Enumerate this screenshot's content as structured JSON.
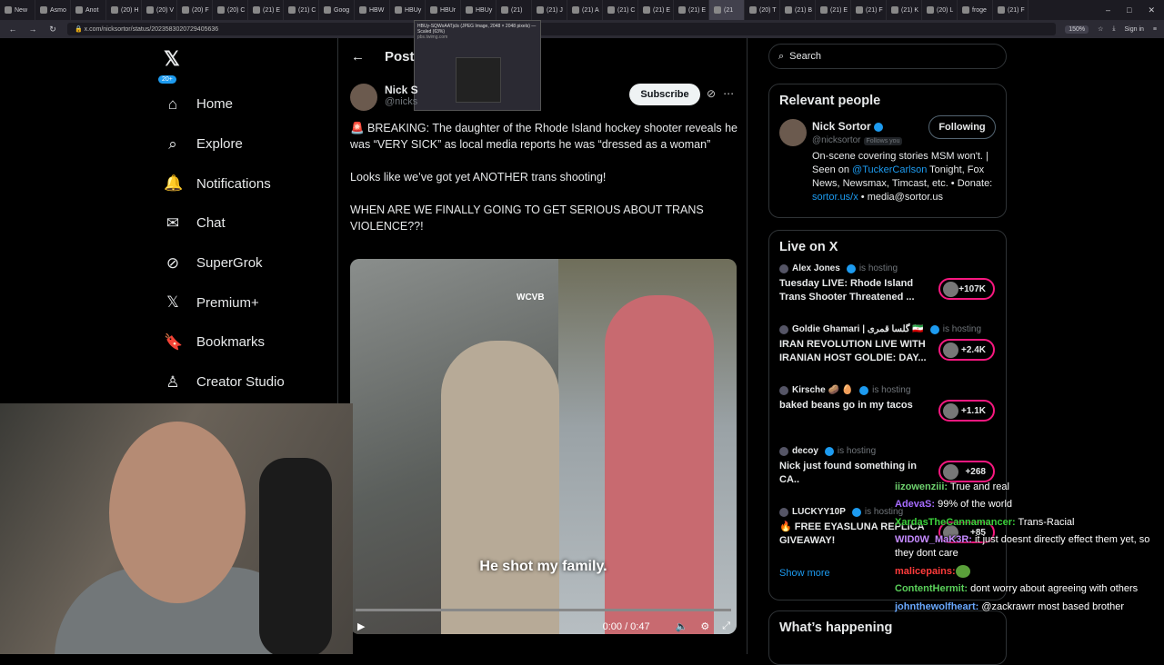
{
  "browser": {
    "tabs": [
      {
        "label": "New",
        "active": false
      },
      {
        "label": "Asmo",
        "active": false
      },
      {
        "label": "Anot",
        "active": false
      },
      {
        "label": "(20) H",
        "active": false
      },
      {
        "label": "(20) V",
        "active": false
      },
      {
        "label": "(20) F",
        "active": false
      },
      {
        "label": "(20) C",
        "active": false
      },
      {
        "label": "(21) E",
        "active": false
      },
      {
        "label": "(21) C",
        "active": false
      },
      {
        "label": "Goog",
        "active": false
      },
      {
        "label": "HBW",
        "active": false
      },
      {
        "label": "HBUy",
        "active": false
      },
      {
        "label": "HBUr",
        "active": false
      },
      {
        "label": "HBUy",
        "active": false
      },
      {
        "label": "(21) ",
        "active": false
      },
      {
        "label": "(21) J",
        "active": false
      },
      {
        "label": "(21) A",
        "active": false
      },
      {
        "label": "(21) C",
        "active": false
      },
      {
        "label": "(21) E",
        "active": false
      },
      {
        "label": "(21) E",
        "active": false
      },
      {
        "label": "(21",
        "active": true
      },
      {
        "label": "(20) T",
        "active": false
      },
      {
        "label": "(21) B",
        "active": false
      },
      {
        "label": "(21) E",
        "active": false
      },
      {
        "label": "(21) F",
        "active": false
      },
      {
        "label": "(21) K",
        "active": false
      },
      {
        "label": "(20) L",
        "active": false
      },
      {
        "label": "froge",
        "active": false
      },
      {
        "label": "(21) F",
        "active": false
      }
    ],
    "url": "x.com/nicksortor/status/2023583020729405636",
    "zoom": "150%",
    "sign_in": "Sign in",
    "tooltip": {
      "title": "HBUy-SQWoAATjcls (JPEG Image, 2048 × 2048 pixels) — Scaled (63%)",
      "domain": "pbs.twimg.com"
    }
  },
  "nav": {
    "items": [
      {
        "label": "Home",
        "icon": "home-icon",
        "glyph": "⌂"
      },
      {
        "label": "Explore",
        "icon": "search-icon",
        "glyph": "⌕"
      },
      {
        "label": "Notifications",
        "icon": "bell-icon",
        "glyph": "🔔",
        "badge": "20+"
      },
      {
        "label": "Chat",
        "icon": "mail-icon",
        "glyph": "✉"
      },
      {
        "label": "SuperGrok",
        "icon": "grok-icon",
        "glyph": "⊘"
      },
      {
        "label": "Premium+",
        "icon": "x-premium-icon",
        "glyph": "𝕏"
      },
      {
        "label": "Bookmarks",
        "icon": "bookmark-icon",
        "glyph": "🔖"
      },
      {
        "label": "Creator Studio",
        "icon": "creator-studio-icon",
        "glyph": "♙"
      }
    ]
  },
  "post": {
    "header_title": "Post",
    "author_name": "Nick S",
    "author_handle": "@nicks",
    "subscribe_label": "Subscribe",
    "text": "🚨 BREAKING: The daughter of the Rhode Island hockey shooter reveals he was “VERY SICK” as local media reports he was “dressed as a woman”\n\nLooks like we’ve got yet ANOTHER trans shooting!\n\nWHEN ARE WE FINALLY GOING TO GET SERIOUS ABOUT TRANS VIOLENCE??!",
    "video": {
      "watermark": "WCVB",
      "caption": "He shot my family.",
      "time": "0:00 / 0:47",
      "progress": 0.0
    }
  },
  "sidebar": {
    "search_placeholder": "Search",
    "relevant_people": {
      "title": "Relevant people",
      "name": "Nick Sortor",
      "handle": "@nicksortor",
      "follows_you": "Follows you",
      "button": "Following",
      "bio_1": "On-scene covering stories MSM won't. | Seen on ",
      "bio_link1": "@TuckerCarlson",
      "bio_2": " Tonight, Fox News, Newsmax, Timcast, etc. • Donate: ",
      "bio_link2": "sortor.us/x",
      "bio_3": " • media@sortor.us"
    },
    "live": {
      "title": "Live on X",
      "hosting_label": "is hosting",
      "items": [
        {
          "host": "Alex Jones",
          "title": "Tuesday LIVE: Rhode Island Trans Shooter Threatened ...",
          "count": "+107K"
        },
        {
          "host": "Goldie Ghamari | گلسا قمری 🇮🇷",
          "title": "IRAN REVOLUTION LIVE WITH IRANIAN HOST GOLDIE: DAY...",
          "count": "+2.4K"
        },
        {
          "host": "Kirsche 🥔 🥚",
          "title": "baked beans go in my tacos",
          "count": "+1.1K"
        },
        {
          "host": "decoy",
          "title": "Nick just found something in CA..",
          "count": "+268"
        },
        {
          "host": "LUCKYY10P",
          "title": "🔥 FREE EYASLUNA REPLICA GIVEAWAY!",
          "count": "+85"
        }
      ],
      "show_more": "Show more"
    },
    "whats_happening": "What’s happening"
  },
  "chat": [
    {
      "user": "iizowenziii:",
      "text": " True and real",
      "color": "#6fd26f"
    },
    {
      "user": "AdevaS:",
      "text": " 99% of the world",
      "color": "#a66bff"
    },
    {
      "user": "XardasTheCannamancer:",
      "text": " Trans-Racial",
      "color": "#3cd13c"
    },
    {
      "user": "WID0W_MaK3R:",
      "text": " it just doesnt directly effect them yet, so they dont care",
      "color": "#c58bff"
    },
    {
      "user": "malicepains:",
      "text": "",
      "color": "#ff3b3b",
      "emote": "pepe-emote"
    },
    {
      "user": "ContentHermit:",
      "text": " dont worry about agreeing with others",
      "color": "#5ad15a"
    },
    {
      "user": "johnthewolfheart:",
      "text": " @zackrawrr most based brother",
      "color": "#6aa9ff"
    }
  ]
}
